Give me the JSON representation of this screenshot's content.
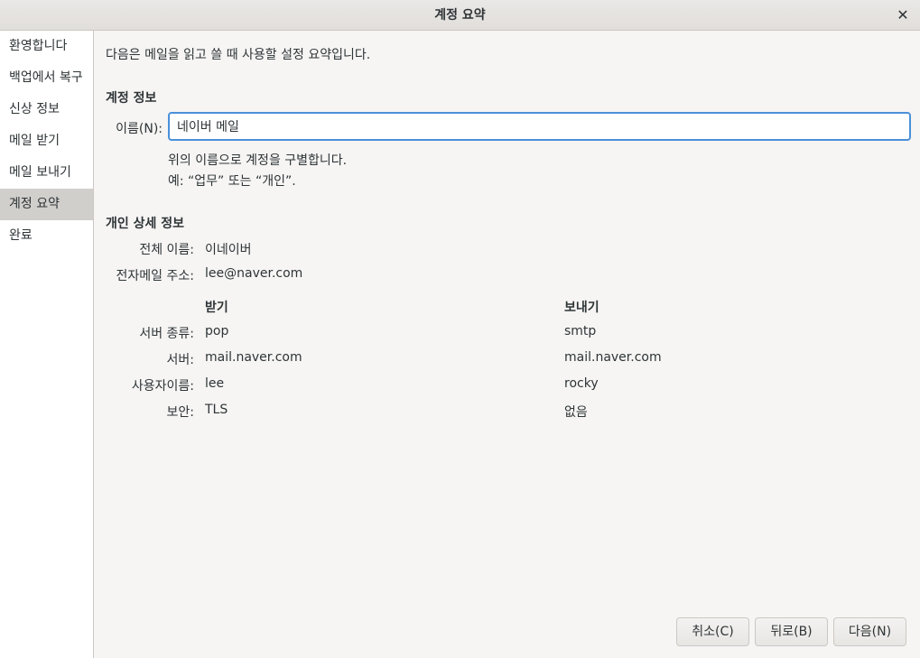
{
  "window": {
    "title": "계정 요약",
    "close_glyph": "✕"
  },
  "sidebar": {
    "items": [
      {
        "label": "환영합니다"
      },
      {
        "label": "백업에서 복구"
      },
      {
        "label": "신상 정보"
      },
      {
        "label": "메일 받기"
      },
      {
        "label": "메일 보내기"
      },
      {
        "label": "계정 요약",
        "active": true
      },
      {
        "label": "완료"
      }
    ]
  },
  "main": {
    "intro": "다음은 메일을 읽고 쓸 때 사용할 설정 요약입니다.",
    "account_info": {
      "heading": "계정 정보",
      "name_label": "이름(N):",
      "name_value": "네이버 메일",
      "hint_line1": "위의 이름으로 계정을 구별합니다.",
      "hint_line2": "예: “업무” 또는 “개인”."
    },
    "personal": {
      "heading": "개인 상세 정보",
      "fullname_label": "전체 이름:",
      "fullname_value": "이네이버",
      "email_label": "전자메일 주소:",
      "email_value": "lee@naver.com"
    },
    "servers": {
      "incoming_heading": "받기",
      "outgoing_heading": "보내기",
      "rows": [
        {
          "label": "서버 종류:",
          "incoming": "pop",
          "outgoing": "smtp"
        },
        {
          "label": "서버:",
          "incoming": "mail.naver.com",
          "outgoing": "mail.naver.com"
        },
        {
          "label": "사용자이름:",
          "incoming": "lee",
          "outgoing": "rocky"
        },
        {
          "label": "보안:",
          "incoming": "TLS",
          "outgoing": "없음"
        }
      ]
    }
  },
  "buttons": {
    "cancel": "취소(C)",
    "back": "뒤로(B)",
    "next": "다음(N)"
  }
}
